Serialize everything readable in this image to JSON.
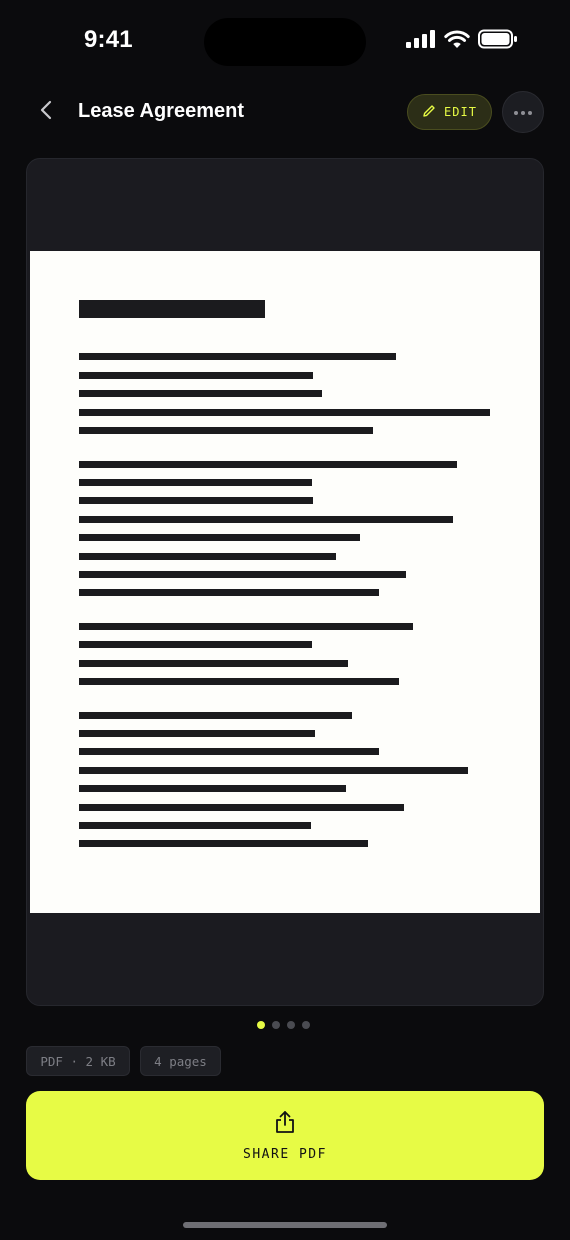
{
  "status_bar": {
    "time": "9:41"
  },
  "header": {
    "title": "Lease Agreement",
    "edit_label": "EDIT",
    "accent_color": "#e7fb45"
  },
  "icons": {
    "back": "chevron-left-icon",
    "edit": "pencil-icon",
    "more": "ellipsis-icon",
    "share": "share-icon",
    "signal": "cellular-signal-icon",
    "wifi": "wifi-icon",
    "battery": "battery-icon"
  },
  "pagination": {
    "total": 4,
    "current": 1
  },
  "meta": {
    "file_info": "PDF · 2 KB",
    "pages": "4 pages"
  },
  "actions": {
    "share_label": "SHARE PDF"
  }
}
